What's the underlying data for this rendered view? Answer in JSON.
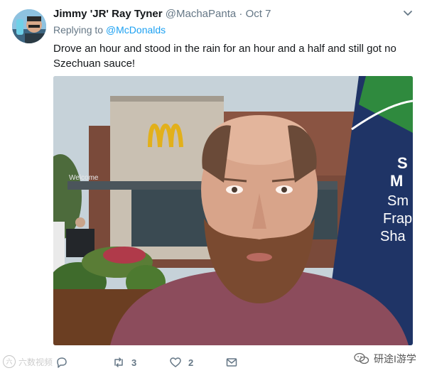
{
  "tweet": {
    "author_name": "Jimmy 'JR' Ray Tyner",
    "author_handle": "@MachaPanta",
    "separator": "·",
    "date": "Oct 7",
    "replying_to_prefix": "Replying to",
    "replying_to_handle": "@McDonalds",
    "text": "Drove an hour and stood in the rain for an hour and a half and still got no Szechuan sauce!"
  },
  "photo": {
    "sign_text": "Welcome",
    "banner_text_lines": [
      "S",
      "M",
      "Sm",
      "Frap",
      "Sha"
    ]
  },
  "actions": {
    "reply_count": "",
    "retweet_count": "3",
    "like_count": "2"
  },
  "watermarks": {
    "left_text": "六数视频",
    "left_logo_text": "六",
    "right_text": "研途I游学"
  },
  "icons": {
    "menu": "chevron-down-icon",
    "reply": "reply-icon",
    "retweet": "retweet-icon",
    "like": "heart-icon",
    "dm": "envelope-icon"
  }
}
